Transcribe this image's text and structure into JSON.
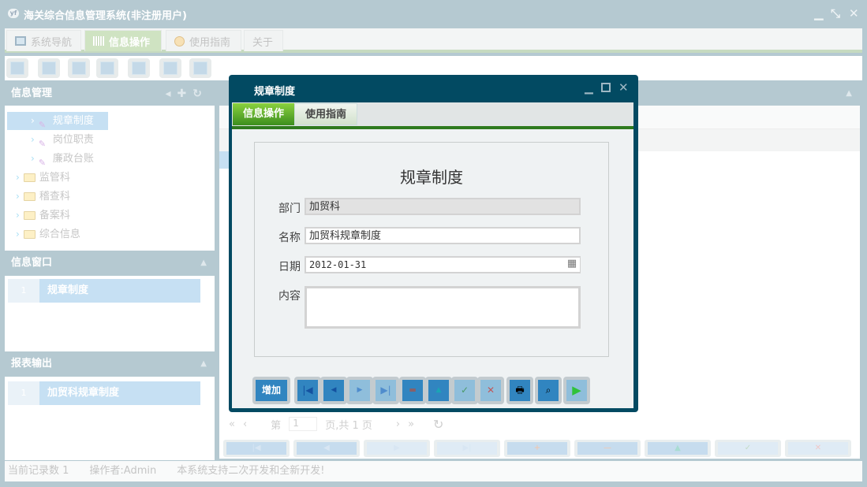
{
  "app": {
    "logo": "yf",
    "title": "海关综合信息管理系统(非注册用户)"
  },
  "main_tabs": [
    {
      "label": "系统导航",
      "icon": "monitor-icon"
    },
    {
      "label": "信息操作",
      "icon": "grid-icon"
    },
    {
      "label": "使用指南",
      "icon": "help-icon"
    },
    {
      "label": "关于"
    }
  ],
  "left": {
    "info_mgmt": {
      "title": "信息管理",
      "tree": [
        "规章制度",
        "岗位职责",
        "廉政台账",
        "监管科",
        "稽查科",
        "备案科",
        "综合信息"
      ]
    },
    "info_window": {
      "title": "信息窗口",
      "rows": [
        {
          "num": "1",
          "label": "规章制度"
        }
      ]
    },
    "report": {
      "title": "报表输出",
      "rows": [
        {
          "num": "1",
          "label": "加贸科规章制度"
        }
      ]
    }
  },
  "pager": {
    "prefix": "第",
    "page": "1",
    "suffix": "页,共 1 页"
  },
  "status": {
    "records": "当前记录数 1",
    "operator": "操作者:Admin",
    "message": "本系统支持二次开发和全新开发!"
  },
  "dialog": {
    "title": "规章制度",
    "tabs": [
      "信息操作",
      "使用指南"
    ],
    "form_title": "规章制度",
    "fields": {
      "dept_label": "部门",
      "dept": "加贸科",
      "name_label": "名称",
      "name": "加贸科规章制度",
      "date_label": "日期",
      "date": "2012-01-31",
      "content_label": "内容",
      "content": ""
    },
    "add_label": "增加"
  }
}
